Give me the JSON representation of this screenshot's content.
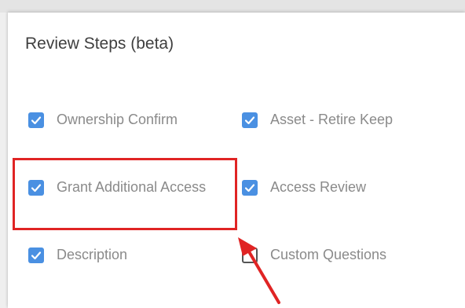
{
  "panel": {
    "title": "Review Steps (beta)",
    "steps": [
      {
        "label": "Ownership Confirm",
        "checked": true
      },
      {
        "label": "Asset - Retire Keep",
        "checked": true
      },
      {
        "label": "Grant Additional Access",
        "checked": true
      },
      {
        "label": "Access Review",
        "checked": true
      },
      {
        "label": "Description",
        "checked": true
      },
      {
        "label": "Custom Questions",
        "checked": false
      }
    ]
  },
  "colors": {
    "checkbox_checked": "#4a90e2",
    "highlight": "#e02424",
    "label_text": "#8a8a8a"
  },
  "icons": {
    "checkbox": "check-icon",
    "annotation_arrow": "arrow-icon"
  }
}
